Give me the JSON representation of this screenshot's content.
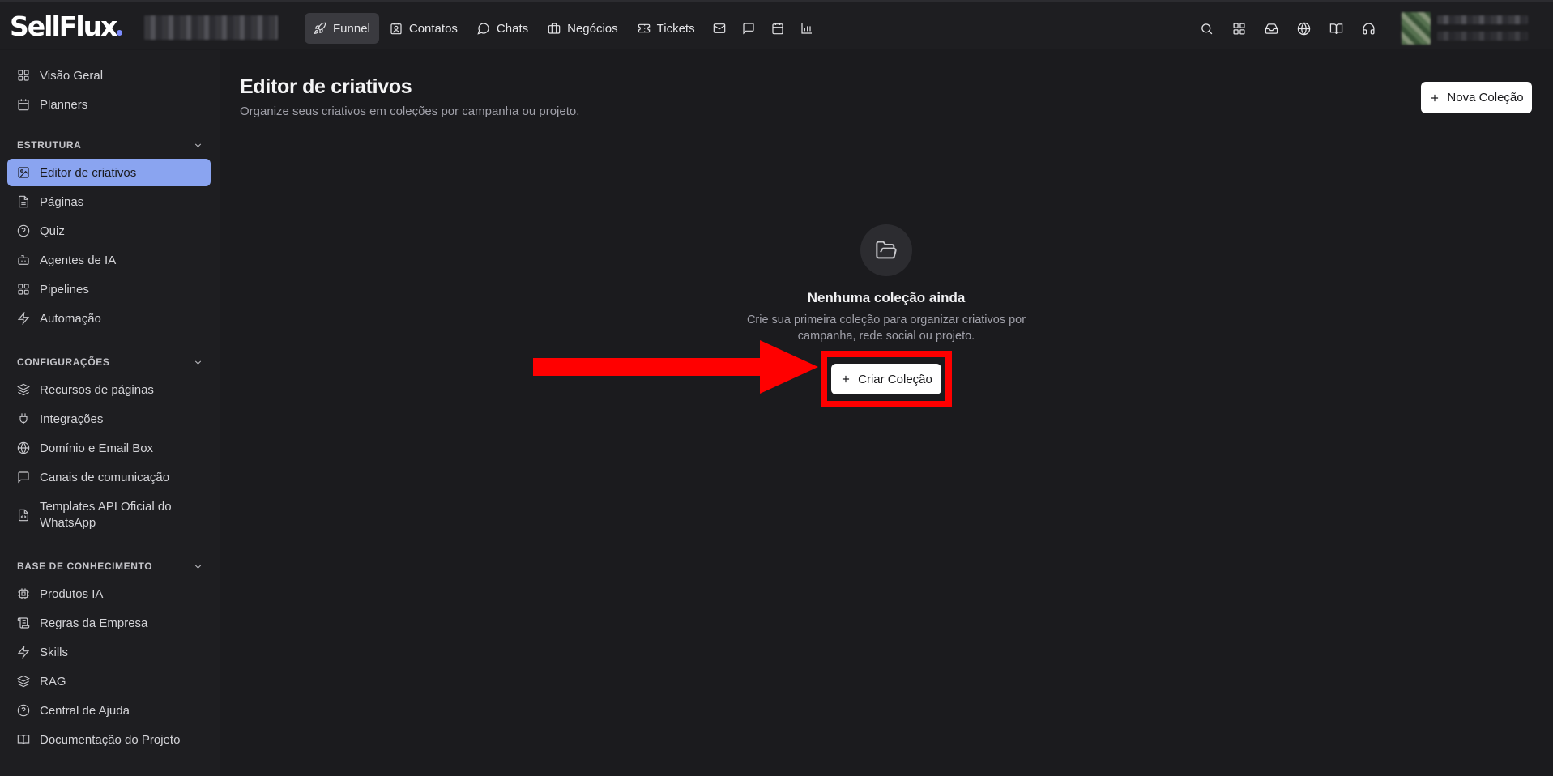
{
  "app": {
    "logo_text": "SellFlux"
  },
  "nav": {
    "items": [
      {
        "label": "Funnel",
        "icon": "rocket-icon",
        "active": true
      },
      {
        "label": "Contatos",
        "icon": "contact-icon"
      },
      {
        "label": "Chats",
        "icon": "chat-icon"
      },
      {
        "label": "Negócios",
        "icon": "briefcase-icon"
      },
      {
        "label": "Tickets",
        "icon": "ticket-icon"
      }
    ],
    "icon_only": [
      "mail-icon",
      "message-square-icon",
      "calendar-icon",
      "bar-chart-icon"
    ]
  },
  "topbar_right_icons": [
    "search-icon",
    "grid-icon",
    "inbox-icon",
    "globe-icon",
    "book-icon",
    "headset-icon"
  ],
  "sidebar": {
    "top_items": [
      {
        "label": "Visão Geral",
        "icon": "layout-grid-icon"
      },
      {
        "label": "Planners",
        "icon": "calendar-icon"
      }
    ],
    "sections": [
      {
        "title": "ESTRUTURA",
        "items": [
          {
            "label": "Editor de criativos",
            "icon": "image-edit-icon",
            "active": true
          },
          {
            "label": "Páginas",
            "icon": "file-icon"
          },
          {
            "label": "Quiz",
            "icon": "help-circle-icon"
          },
          {
            "label": "Agentes de IA",
            "icon": "bot-icon"
          },
          {
            "label": "Pipelines",
            "icon": "layout-grid-icon"
          },
          {
            "label": "Automação",
            "icon": "zap-icon"
          }
        ]
      },
      {
        "title": "CONFIGURAÇÕES",
        "items": [
          {
            "label": "Recursos de páginas",
            "icon": "layers-icon"
          },
          {
            "label": "Integrações",
            "icon": "plug-icon"
          },
          {
            "label": "Domínio e Email Box",
            "icon": "globe-icon"
          },
          {
            "label": "Canais de comunicação",
            "icon": "message-square-icon"
          },
          {
            "label": "Templates API Oficial do WhatsApp",
            "icon": "file-code-icon"
          }
        ]
      },
      {
        "title": "BASE DE CONHECIMENTO",
        "items": [
          {
            "label": "Produtos IA",
            "icon": "cpu-icon"
          },
          {
            "label": "Regras da Empresa",
            "icon": "scroll-icon"
          },
          {
            "label": "Skills",
            "icon": "zap-icon"
          },
          {
            "label": "RAG",
            "icon": "layers-icon"
          },
          {
            "label": "Central de Ajuda",
            "icon": "help-circle-icon"
          },
          {
            "label": "Documentação do Projeto",
            "icon": "book-icon"
          }
        ]
      }
    ]
  },
  "main": {
    "title": "Editor de criativos",
    "subtitle": "Organize seus criativos em coleções por campanha ou projeto.",
    "new_button": "Nova Coleção",
    "empty_state": {
      "icon": "folder-open-icon",
      "title": "Nenhuma coleção ainda",
      "description": "Crie sua primeira coleção para organizar criativos por campanha, rede social ou projeto.",
      "button": "Criar Coleção"
    }
  },
  "annotation": {
    "highlight_color": "#ff0000",
    "arrow_color": "#ff0000"
  }
}
